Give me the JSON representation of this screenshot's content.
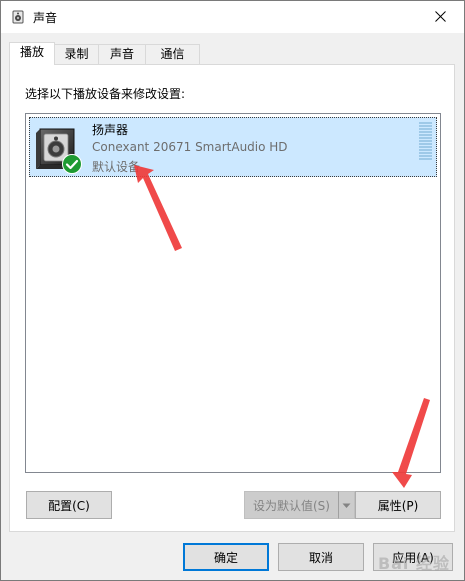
{
  "window": {
    "title": "声音",
    "accent_color": "#0078d7"
  },
  "tabs": [
    {
      "label": "播放",
      "active": true
    },
    {
      "label": "录制",
      "active": false
    },
    {
      "label": "声音",
      "active": false
    },
    {
      "label": "通信",
      "active": false
    }
  ],
  "playback": {
    "instruction": "选择以下播放设备来修改设置:",
    "devices": [
      {
        "name": "扬声器",
        "driver": "Conexant 20671 SmartAudio HD",
        "status": "默认设备",
        "icon": "speaker-icon",
        "badge_icon": "checkmark-icon",
        "badge_color": "#1e9a32",
        "selected": true
      }
    ],
    "buttons": {
      "configure": "配置(C)",
      "set_default": "设为默认值(S)",
      "properties": "属性(P)"
    }
  },
  "dialog_buttons": {
    "ok": "确定",
    "cancel": "取消",
    "apply": "应用(A)"
  },
  "watermark": "Bai 经验"
}
